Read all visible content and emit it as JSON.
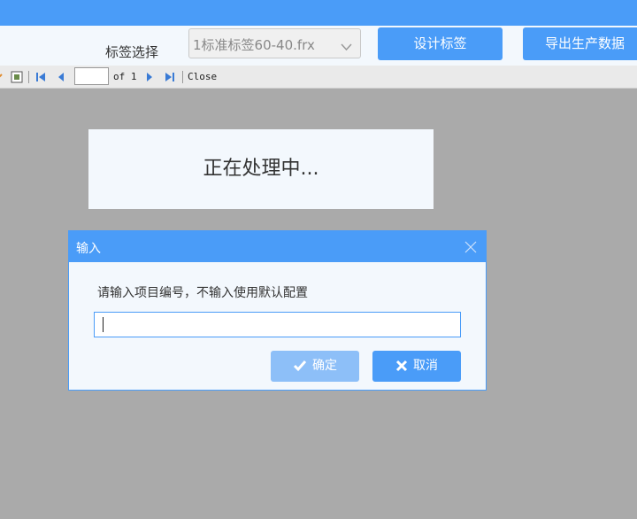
{
  "toolbar": {
    "label_select": "标签选择",
    "select_value": "1标准标签60-40.frx",
    "design_button": "设计标签",
    "export_button": "导出生产数据"
  },
  "nav": {
    "page_value": "",
    "of_text": "of 1",
    "close_text": "Close"
  },
  "processing": {
    "text": "正在处理中..."
  },
  "dialog": {
    "title": "输入",
    "prompt": "请输入项目编号，不输入使用默认配置",
    "input_value": "",
    "ok_label": "确定",
    "cancel_label": "取消"
  },
  "colors": {
    "accent": "#4a9cf8",
    "disabled_button": "#8dbff8",
    "background": "#aaaaaa",
    "panel": "#f3f8fd"
  },
  "icons": [
    "chevron-down-icon",
    "print-icon",
    "first-page-icon",
    "prev-page-icon",
    "next-page-icon",
    "last-page-icon",
    "close-icon",
    "check-icon",
    "x-icon"
  ]
}
